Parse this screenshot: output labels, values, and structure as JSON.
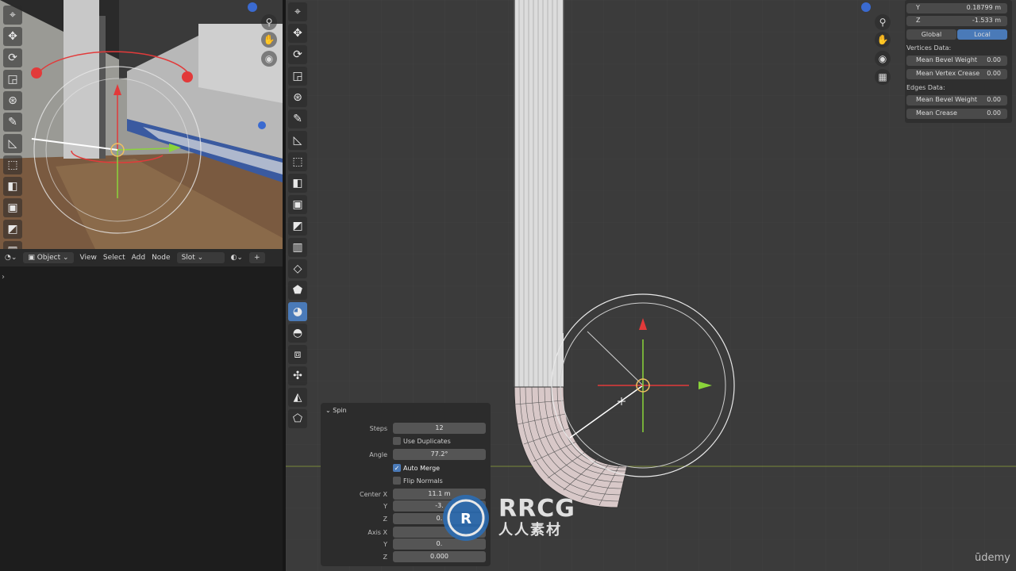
{
  "left_header": {
    "mode": "Object",
    "menus": [
      "View",
      "Select",
      "Add",
      "Node"
    ],
    "slot": "Slot"
  },
  "properties": {
    "y_label": "Y",
    "y_value": "0.18799 m",
    "z_label": "Z",
    "z_value": "-1.533 m",
    "global_label": "Global",
    "local_label": "Local",
    "vertices_header": "Vertices Data:",
    "mean_bevel_weight_label": "Mean Bevel Weight",
    "mean_bevel_weight_v": "0.00",
    "mean_vertex_crease_label": "Mean Vertex Crease",
    "mean_vertex_crease_v": "0.00",
    "edges_header": "Edges Data:",
    "edge_bevel_weight_label": "Mean Bevel Weight",
    "edge_bevel_weight_v": "0.00",
    "mean_crease_label": "Mean Crease",
    "mean_crease_v": "0.00"
  },
  "spin": {
    "title": "Spin",
    "steps_label": "Steps",
    "steps": "12",
    "use_duplicates": "Use Duplicates",
    "angle_label": "Angle",
    "angle": "77.2°",
    "auto_merge": "Auto Merge",
    "flip_normals": "Flip Normals",
    "center_x_label": "Center X",
    "center_x": "11.1 m",
    "center_y_label": "Y",
    "center_y": "-3.",
    "center_z_label": "Z",
    "center_z": "0.",
    "axis_x_label": "Axis X",
    "axis_x": "",
    "axis_y_label": "Y",
    "axis_y": "0.",
    "axis_z_label": "Z",
    "axis_z": "0.000"
  },
  "watermark": {
    "big": "RRCG",
    "small": "人人素材"
  },
  "brand": "ūdemy",
  "colors": {
    "accent": "#4a7ab8",
    "x_axis": "#e23a3a",
    "y_axis": "#8ad43a"
  }
}
